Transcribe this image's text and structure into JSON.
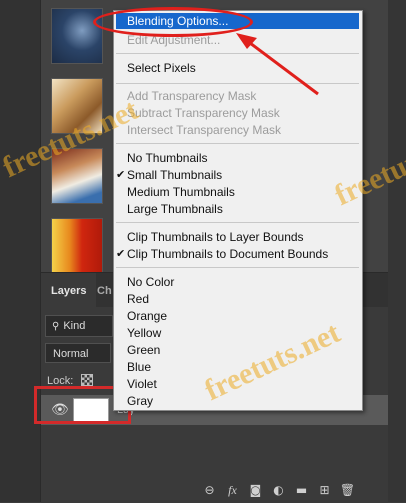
{
  "thumbnails": [
    {
      "name": "thumbnail-1",
      "colors": [
        "#1c2c45",
        "#7f9cc0"
      ]
    },
    {
      "name": "thumbnail-2",
      "colors": [
        "#8c5a2a",
        "#f2e3c4"
      ]
    },
    {
      "name": "thumbnail-3",
      "colors": [
        "#7a2c1c",
        "#f0ece2"
      ]
    },
    {
      "name": "thumbnail-4",
      "colors": [
        "#d0260f",
        "#f4d24a"
      ]
    }
  ],
  "layers_panel": {
    "tab_layers": "Layers",
    "tab_other": "Ch",
    "filter_value": "Kind",
    "blend_mode": "Normal",
    "lock_label": "Lock:",
    "layer_name": "Lay",
    "footer_icons": [
      "link-icon",
      "fx-icon",
      "mask-icon",
      "adjustment-icon",
      "folder-icon",
      "new-layer-icon",
      "trash-icon"
    ]
  },
  "context_menu": {
    "items": [
      {
        "label": "Blending Options...",
        "state": "highlight"
      },
      {
        "label": "Edit Adjustment...",
        "state": "disabled"
      },
      {
        "label": "Select Pixels",
        "state": "normal"
      },
      {
        "label": "Add Transparency Mask",
        "state": "disabled"
      },
      {
        "label": "Subtract Transparency Mask",
        "state": "disabled"
      },
      {
        "label": "Intersect Transparency Mask",
        "state": "disabled"
      },
      {
        "label": "No Thumbnails",
        "state": "normal"
      },
      {
        "label": "Small Thumbnails",
        "state": "checked"
      },
      {
        "label": "Medium Thumbnails",
        "state": "normal"
      },
      {
        "label": "Large Thumbnails",
        "state": "normal"
      },
      {
        "label": "Clip Thumbnails to Layer Bounds",
        "state": "normal"
      },
      {
        "label": "Clip Thumbnails to Document Bounds",
        "state": "checked"
      },
      {
        "label": "No Color",
        "state": "normal"
      },
      {
        "label": "Red",
        "state": "normal"
      },
      {
        "label": "Orange",
        "state": "normal"
      },
      {
        "label": "Yellow",
        "state": "normal"
      },
      {
        "label": "Green",
        "state": "normal"
      },
      {
        "label": "Blue",
        "state": "normal"
      },
      {
        "label": "Violet",
        "state": "normal"
      },
      {
        "label": "Gray",
        "state": "normal"
      }
    ]
  },
  "watermark": "freetuts.net",
  "colors": {
    "highlight": "#1667cc",
    "annotation": "#e0201c",
    "watermark": "#ecac24"
  }
}
